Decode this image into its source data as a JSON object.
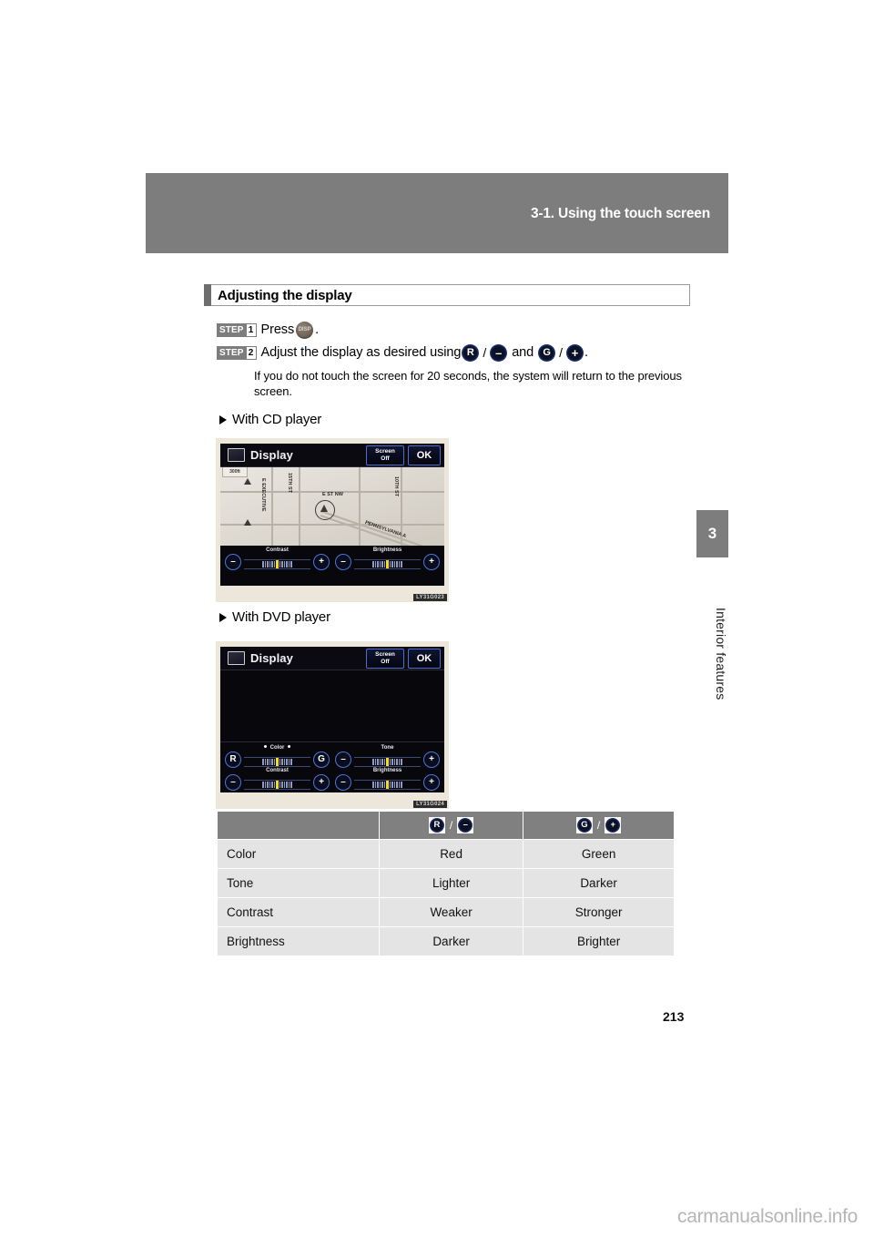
{
  "header": {
    "section_title": "3-1. Using the touch screen"
  },
  "chapter_tab": {
    "number": "3",
    "label": "Interior features"
  },
  "section": {
    "title": "Adjusting the display"
  },
  "steps": [
    {
      "word": "STEP",
      "number": "1",
      "text_before": "Press",
      "icon": "disp-button",
      "icon_label": "DISP",
      "text_after": "."
    },
    {
      "word": "STEP",
      "number": "2",
      "text_before": "Adjust the display as desired using",
      "text_mid": "and",
      "text_after": "."
    }
  ],
  "note": "If you do not touch the screen for 20 seconds, the system will return to the previous screen.",
  "figures": {
    "cd": {
      "caption": "With CD player",
      "code": "LY31G023",
      "screen": {
        "title": "Display",
        "buttons": {
          "screen_off_line1": "Screen",
          "screen_off_line2": "Off",
          "ok": "OK"
        },
        "map": {
          "zoom_label": "300ft",
          "labels": [
            "E EXECUTIVE",
            "15TH ST",
            "E ST NW",
            "10TH ST",
            "PENNSYLVANIA A"
          ]
        },
        "sliders": [
          {
            "name": "Contrast",
            "minus": "–",
            "plus": "+",
            "ticks": 13,
            "active": 6
          },
          {
            "name": "Brightness",
            "minus": "–",
            "plus": "+",
            "ticks": 13,
            "active": 6
          }
        ]
      }
    },
    "dvd": {
      "caption": "With DVD player",
      "code": "LY31G024",
      "screen": {
        "title": "Display",
        "buttons": {
          "screen_off_line1": "Screen",
          "screen_off_line2": "Off",
          "ok": "OK"
        },
        "sliders": [
          {
            "name": "Color",
            "minus": "R",
            "plus": "G",
            "ticks": 13,
            "active": 6,
            "dots": true
          },
          {
            "name": "Tone",
            "minus": "–",
            "plus": "+",
            "ticks": 13,
            "active": 6
          },
          {
            "name": "Contrast",
            "minus": "–",
            "plus": "+",
            "ticks": 13,
            "active": 6
          },
          {
            "name": "Brightness",
            "minus": "–",
            "plus": "+",
            "ticks": 13,
            "active": 6
          }
        ]
      }
    }
  },
  "table": {
    "header_cells": [
      {
        "label": ""
      },
      {
        "icon_left": "R",
        "icon_right": "–"
      },
      {
        "icon_left": "G",
        "icon_right": "+"
      }
    ],
    "rows": [
      {
        "label": "Color",
        "minus": "Red",
        "plus": "Green"
      },
      {
        "label": "Tone",
        "minus": "Lighter",
        "plus": "Darker"
      },
      {
        "label": "Contrast",
        "minus": "Weaker",
        "plus": "Stronger"
      },
      {
        "label": "Brightness",
        "minus": "Darker",
        "plus": "Brighter"
      }
    ]
  },
  "icons": {
    "r": "R",
    "g": "G",
    "minus": "–",
    "plus": "+",
    "slash": "/",
    "disp": "DISP"
  },
  "page_number": "213",
  "watermark": "carmanualsonline.info",
  "colors": {
    "band_gray": "#7d7d7d",
    "table_header_gray": "#808080",
    "table_row_gray": "#e4e4e4",
    "screen_black": "#08080c",
    "slider_yellow": "#f5dd18",
    "button_blue": "#4f74d8"
  }
}
